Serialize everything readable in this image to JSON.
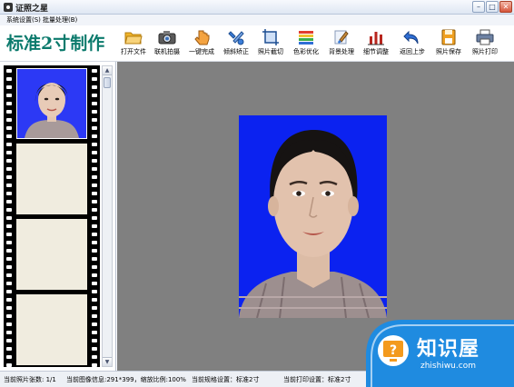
{
  "window": {
    "title": "证照之星",
    "buttons": [
      "minimize",
      "maximize",
      "close"
    ]
  },
  "menu": [
    {
      "label": "系统设置(S)"
    },
    {
      "label": "批量处理(B)"
    }
  ],
  "toolbar": {
    "heading": "标准2寸制作",
    "buttons": [
      {
        "label": "打开文件",
        "icon": "folder-open-icon"
      },
      {
        "label": "联机拍摄",
        "icon": "camera-icon"
      },
      {
        "label": "一键完成",
        "icon": "hand-pointer-icon"
      },
      {
        "label": "倾斜矫正",
        "icon": "rotate-wrench-icon"
      },
      {
        "label": "照片截切",
        "icon": "crop-icon"
      },
      {
        "label": "色彩优化",
        "icon": "color-bars-icon"
      },
      {
        "label": "背景处理",
        "icon": "brush-icon"
      },
      {
        "label": "细节调整",
        "icon": "adjust-bars-icon"
      },
      {
        "label": "返回上步",
        "icon": "undo-arrow-icon"
      },
      {
        "label": "照片保存",
        "icon": "floppy-disk-icon"
      },
      {
        "label": "照片打印",
        "icon": "printer-icon"
      }
    ]
  },
  "colors": {
    "heading": "#0b7a6c",
    "photo_background": "#0b22f0",
    "canvas": "#808080",
    "film": "#000000",
    "empty_frame": "#f0ecdf"
  },
  "status": {
    "photo_count": "当前照片张数: 1/1",
    "image_info": "当前图像信息:291*399，缩放比例:100%",
    "spec_setting": "当前规格设置：标准2寸",
    "print_setting": "当前打印设置：标准2寸"
  },
  "watermark": {
    "text": "知识屋",
    "url": "zhishiwu.com"
  }
}
